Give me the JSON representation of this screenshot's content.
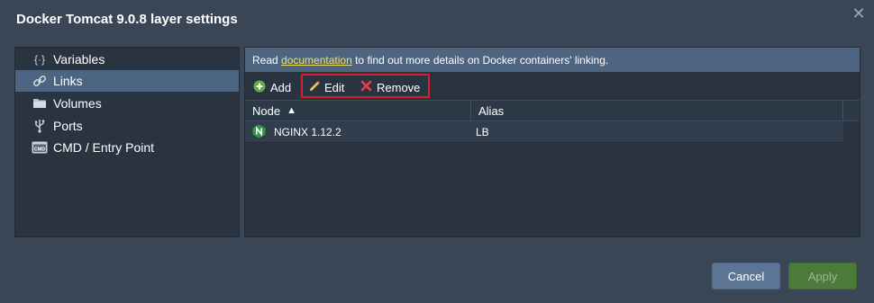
{
  "dialog": {
    "title": "Docker Tomcat 9.0.8 layer settings",
    "close_icon": "close-icon"
  },
  "sidebar": {
    "items": [
      {
        "label": "Variables",
        "icon": "variables-braces-icon",
        "active": false
      },
      {
        "label": "Links",
        "icon": "link-icon",
        "active": true
      },
      {
        "label": "Volumes",
        "icon": "folder-icon",
        "active": false
      },
      {
        "label": "Ports",
        "icon": "usb-port-icon",
        "active": false
      },
      {
        "label": "CMD / Entry Point",
        "icon": "cmd-icon",
        "active": false
      }
    ]
  },
  "info": {
    "prefix": "Read ",
    "link": "documentation",
    "suffix": " to find out more details on Docker containers' linking."
  },
  "toolbar": {
    "add_label": "Add",
    "edit_label": "Edit",
    "remove_label": "Remove"
  },
  "grid": {
    "columns": [
      "Node",
      "Alias"
    ],
    "sort_indicator": "▲",
    "rows": [
      {
        "node": "NGINX 1.12.2",
        "alias": "LB",
        "icon": "nginx-icon"
      }
    ]
  },
  "footer": {
    "cancel_label": "Cancel",
    "apply_label": "Apply"
  },
  "colors": {
    "background": "#3a4656",
    "panel": "#2a3441",
    "active_item": "#4c6582",
    "info_bar": "#4d6580",
    "link": "#f0e26b",
    "highlight_border": "#d9202a",
    "cancel_button": "#5c7594",
    "apply_button": "#4b7a3a",
    "nginx_green": "#2f9a3e"
  }
}
